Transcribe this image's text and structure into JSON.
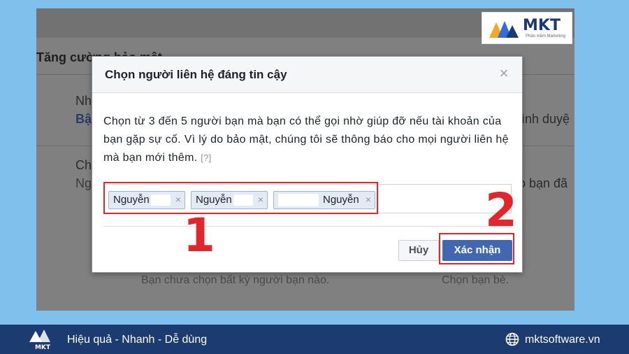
{
  "background": {
    "heading": "Tăng cường bảo mật",
    "rows": [
      {
        "left_a": "Nh",
        "left_b": "Bậ",
        "right": "rình duyệ"
      },
      {
        "left_a": "Ch",
        "left_b": "Ng",
        "right": "o bạn đã"
      }
    ],
    "bottom_left": "Bạn chưa chọn bất kỳ người bạn nào.",
    "bottom_right": "Chọn bạn bè."
  },
  "dialog": {
    "title": "Chọn người liên hệ đáng tin cậy",
    "close_glyph": "×",
    "body": "Chọn từ 3 đến 5 người bạn mà bạn có thể gọi nhờ giúp đỡ nếu tài khoản của bạn gặp sự cố. Vì lý do bảo mật, chúng tôi sẽ thông báo cho mọi người liên hệ mà bạn mới thêm.",
    "help": "[?]",
    "tokens": [
      {
        "label": "Nguyễn"
      },
      {
        "label": "Nguyễn"
      },
      {
        "label": "Nguyễn"
      }
    ],
    "token_remove_glyph": "×",
    "cancel_label": "Hủy",
    "confirm_label": "Xác nhận"
  },
  "annotations": {
    "step1": "1",
    "step2": "2",
    "color": "#e3262b"
  },
  "brand": {
    "logo_text": "MKT",
    "logo_sub": "Phần mềm Marketing",
    "footer_logo_text": "MKT",
    "tagline": "Hiệu quả - Nhanh - Dễ dùng",
    "website": "mktsoftware.vn",
    "primary_color": "#1c3b70",
    "button_color": "#4267b2"
  }
}
